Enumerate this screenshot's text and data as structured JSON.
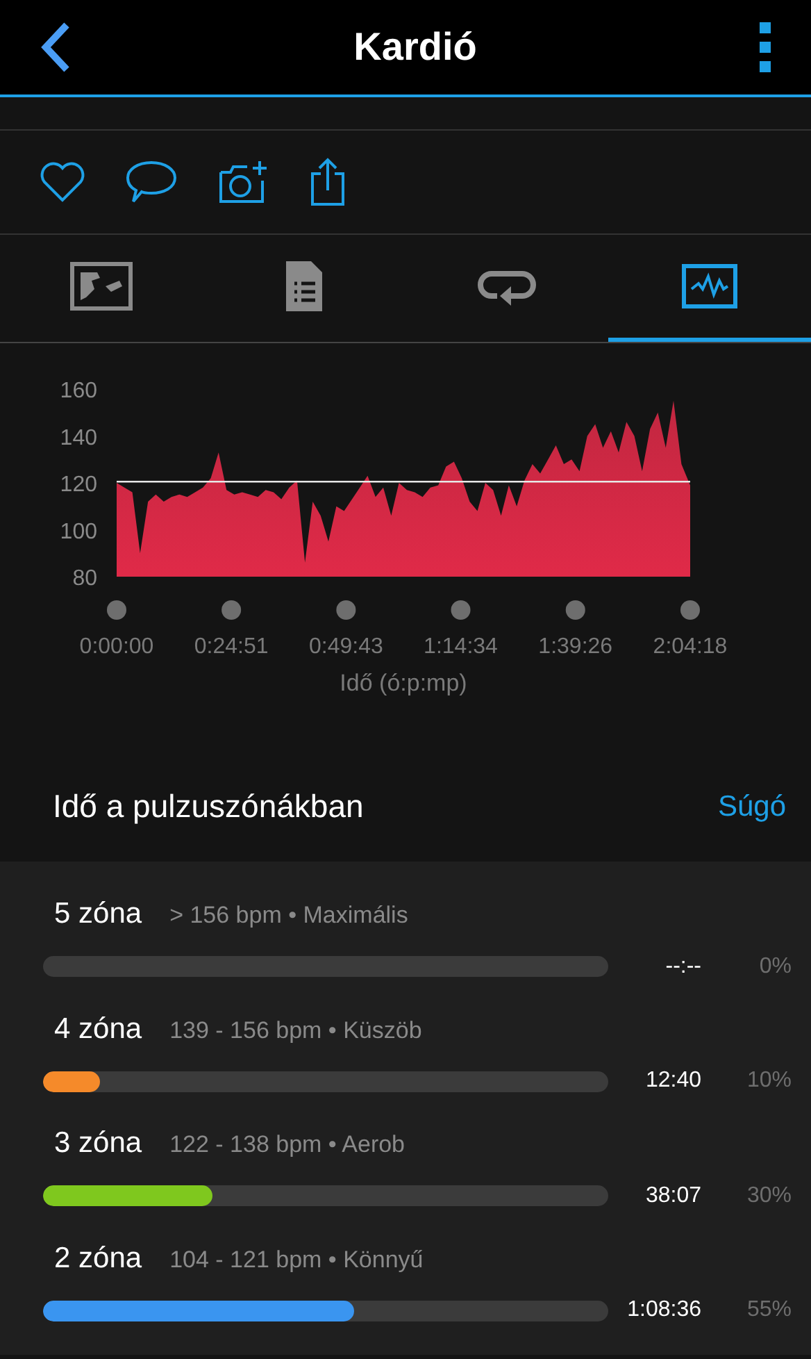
{
  "header": {
    "title": "Kardió"
  },
  "tabs": [
    {
      "selected": false
    },
    {
      "selected": false
    },
    {
      "selected": false
    },
    {
      "selected": true
    }
  ],
  "chart": {
    "chart_data": {
      "type": "area",
      "xlabel": "Idő (ó:p:mp)",
      "ylim": [
        80,
        160
      ],
      "yticks": [
        80,
        100,
        120,
        140,
        160
      ],
      "xlim": [
        0,
        7458
      ],
      "xticks": [
        {
          "value": 0,
          "label": "0:00:00"
        },
        {
          "value": 1491,
          "label": "0:24:51"
        },
        {
          "value": 2983,
          "label": "0:49:43"
        },
        {
          "value": 4474,
          "label": "1:14:34"
        },
        {
          "value": 5966,
          "label": "1:39:26"
        },
        {
          "value": 7458,
          "label": "2:04:18"
        }
      ],
      "x": [
        0,
        102,
        204,
        306,
        408,
        510,
        612,
        714,
        816,
        918,
        1020,
        1122,
        1224,
        1326,
        1428,
        1530,
        1632,
        1734,
        1836,
        1938,
        2040,
        2142,
        2244,
        2346,
        2448,
        2550,
        2652,
        2754,
        2856,
        2958,
        3060,
        3162,
        3264,
        3366,
        3468,
        3570,
        3672,
        3774,
        3876,
        3978,
        4080,
        4182,
        4284,
        4386,
        4488,
        4590,
        4692,
        4794,
        4896,
        4998,
        5100,
        5202,
        5304,
        5406,
        5508,
        5610,
        5712,
        5814,
        5916,
        6018,
        6120,
        6222,
        6324,
        6426,
        6528,
        6630,
        6732,
        6834,
        6936,
        7038,
        7140,
        7242,
        7344,
        7458
      ],
      "series": [
        {
          "color": "#e02a48",
          "values": [
            120,
            118,
            116,
            90,
            112,
            115,
            112,
            114,
            115,
            114,
            116,
            118,
            122,
            133,
            117,
            115,
            116,
            115,
            114,
            117,
            116,
            113,
            118,
            121,
            86,
            112,
            106,
            95,
            110,
            108,
            113,
            118,
            123,
            114,
            118,
            106,
            120,
            117,
            116,
            114,
            118,
            119,
            127,
            129,
            122,
            112,
            108,
            120,
            117,
            106,
            119,
            110,
            121,
            128,
            124,
            130,
            136,
            128,
            130,
            125,
            140,
            145,
            135,
            142,
            133,
            146,
            140,
            125,
            143,
            150,
            135,
            155,
            128,
            119
          ]
        }
      ]
    }
  },
  "zones_header": {
    "title": "Idő a pulzuszónákban",
    "link": "Súgó"
  },
  "zones": [
    {
      "name": "5 zóna",
      "range": "> 156 bpm • Maximális",
      "time": "--:--",
      "percent": "0%"
    },
    {
      "name": "4 zóna",
      "range": "139 - 156 bpm • Küszöb",
      "time": "12:40",
      "percent": "10%",
      "level": 0.1,
      "color": "#f58a2a"
    },
    {
      "name": "3 zóna",
      "range": "122 - 138 bpm • Aerob",
      "time": "38:07",
      "percent": "30%",
      "level": 0.3,
      "color": "#7fc81e"
    },
    {
      "name": "2 zóna",
      "range": "104 - 121 bpm • Könnyű",
      "time": "1:08:36",
      "percent": "55%",
      "level": 0.55,
      "color": "#3a95f0"
    }
  ]
}
